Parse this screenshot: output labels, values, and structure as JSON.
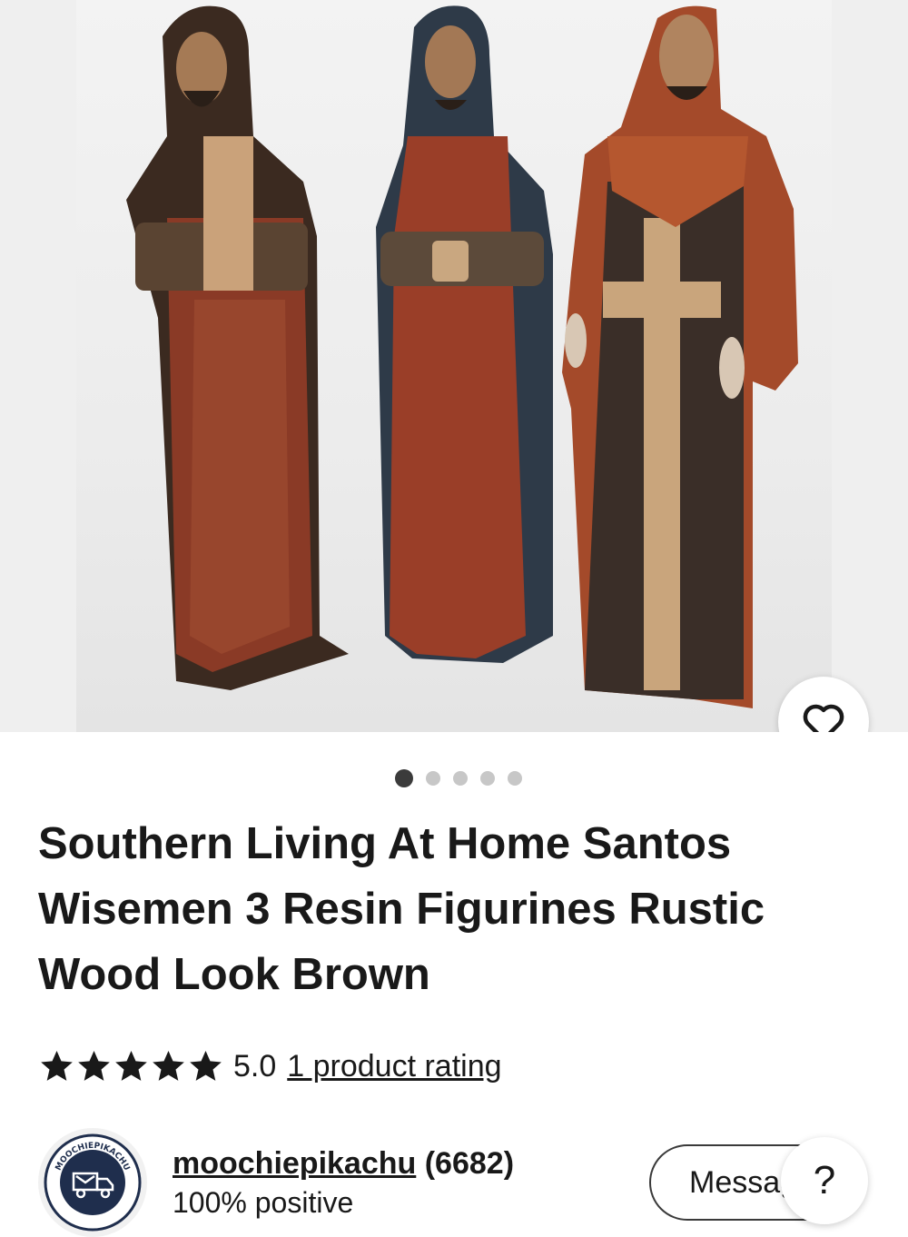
{
  "listing": {
    "image_count": 5,
    "active_image_index": 0,
    "title": "Southern Living At Home Santos Wisemen 3 Resin Figurines Rustic Wood Look Brown",
    "rating": {
      "value": "5.0",
      "stars": 5,
      "link_text": "1 product rating"
    }
  },
  "seller": {
    "name": "moochiepikachu",
    "count": "(6682)",
    "feedback": "100% positive",
    "badge_text": "MOOCHIEPIKACHU"
  },
  "actions": {
    "message_label": "Message",
    "help_label": "?"
  },
  "icons": {
    "favorite": "heart-icon",
    "star": "star-icon",
    "seller_badge": "shipping-truck-icon"
  },
  "colors": {
    "text": "#191919",
    "dot_active": "#3b3b3b",
    "dot_inactive": "#c7c7c7"
  }
}
